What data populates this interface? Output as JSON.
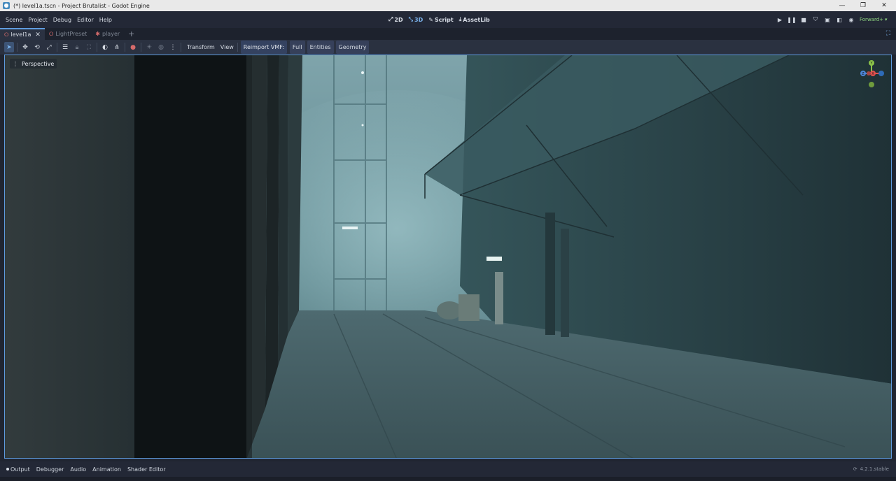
{
  "window": {
    "title": "(*) level1a.tscn - Project Brutalist - Godot Engine",
    "controls": {
      "minimize": "—",
      "maximize": "❐",
      "close": "✕"
    }
  },
  "menu": {
    "items": [
      "Scene",
      "Project",
      "Debug",
      "Editor",
      "Help"
    ],
    "main_screens": [
      {
        "label": "2D",
        "icon": "2d-icon"
      },
      {
        "label": "3D",
        "icon": "3d-icon",
        "active": true
      },
      {
        "label": "Script",
        "icon": "script-icon"
      },
      {
        "label": "AssetLib",
        "icon": "assetlib-icon"
      }
    ],
    "renderer": "Forward+"
  },
  "scene_tabs": [
    {
      "label": "level1a",
      "active": true,
      "close": "✕"
    },
    {
      "label": "LightPreset"
    },
    {
      "label": "player"
    }
  ],
  "toolbar": {
    "transform_label": "Transform",
    "view_label": "View",
    "reimport_label": "Reimport VMF:",
    "full_label": "Full",
    "entities_label": "Entities",
    "geometry_label": "Geometry"
  },
  "viewport": {
    "perspective_label": "Perspective",
    "gizmo_axes": {
      "y": "Y",
      "z": "Z",
      "x": "X"
    },
    "colors": {
      "y": "#8bc34a",
      "x": "#e0504d",
      "z": "#4c86d8"
    }
  },
  "bottom_panel": {
    "tabs": [
      "Output",
      "Debugger",
      "Audio",
      "Animation",
      "Shader Editor"
    ],
    "version": "4.2.1.stable"
  },
  "colors": {
    "accent": "#5e9bde",
    "panel": "#232836",
    "renderer": "#8ed480"
  }
}
